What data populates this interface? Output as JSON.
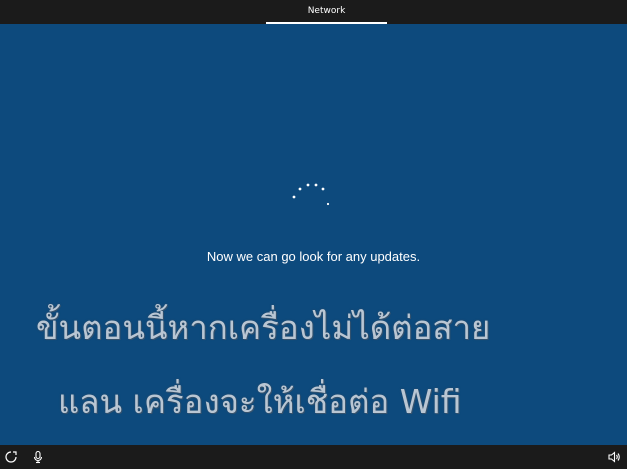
{
  "header": {
    "tab_label": "Network"
  },
  "main": {
    "status_text": "Now we can go look for any updates.",
    "caption_line1": "ขั้นตอนนี้หากเครื่องไม่ได้ต่อสาย",
    "caption_line2": "แลน เครื่องจะให้เชื่อต่อ Wifi"
  },
  "taskbar": {
    "left_icons": [
      "ease-of-access-icon",
      "microphone-icon"
    ],
    "right_icons": [
      "volume-icon"
    ]
  },
  "colors": {
    "background": "#0d4a7d",
    "bar": "#1b1b1b",
    "text": "#ffffff"
  }
}
